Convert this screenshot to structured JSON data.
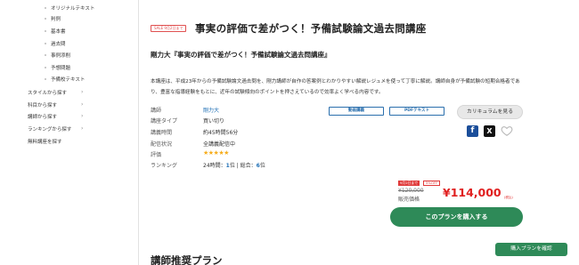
{
  "sidebar": {
    "sub_items": [
      "オリジナルテキスト",
      "判例",
      "基本書",
      "過去問",
      "事例添削",
      "予想問題",
      "予備校テキスト"
    ],
    "categories": [
      "スタイルから探す",
      "科目から探す",
      "講師から探す",
      "ランキングから探す",
      "無料講座を探す"
    ],
    "arrow": "›"
  },
  "course": {
    "sale_badge": "SALE 9月2日まで",
    "title": "事実の評価で差がつく！予備試験論文過去問講座",
    "subtitle": "剛力大『事実の評価で差がつく！予備試験論文過去問講座』",
    "description": "本講座は、平成23年からの予備試験論文過去問を、剛力講師が自作の答案例とわかりやすい解説レジュメを使って丁寧に解説。講師自身が予備試験の短期合格者であり、豊富な指導経験をもとに、近年の試験傾向のポイントを押さえているので効率よく学べる内容です。"
  },
  "info": {
    "labels": [
      "講師",
      "講座タイプ",
      "講義時間",
      "配信状況",
      "評価",
      "ランキング"
    ],
    "instructor": "剛力大",
    "type": "買い切り",
    "duration": "約45時間56分",
    "status": "全講義配信中",
    "rating_stars": "★★★★★",
    "rating_value": 5,
    "ranking_prefix": "24時間：",
    "ranking_24h": "1",
    "ranking_mid": "位 | 総合：",
    "ranking_total": "6",
    "ranking_suffix": "位"
  },
  "tags": [
    "動画講義",
    "PDFテキスト"
  ],
  "buttons": {
    "curriculum": "カリキュラムを見る",
    "buy": "このプランを購入する",
    "confirm": "購入プランを確認"
  },
  "social": {
    "facebook": "f",
    "x": "X"
  },
  "price": {
    "sale_tag": "9月2日まで",
    "off_tag": "5%OFF",
    "old_price": "¥120,000",
    "price": "¥114,000",
    "tax": "(税込)",
    "label": "販売価格"
  },
  "section": {
    "title": "講師推奨プラン"
  },
  "colors": {
    "accent_green": "#2e8a58",
    "price_red": "#e02020",
    "link_blue": "#1f6fb5",
    "star": "#f6ad1c"
  },
  "icons": {
    "favorite": "heart-outline-icon"
  }
}
